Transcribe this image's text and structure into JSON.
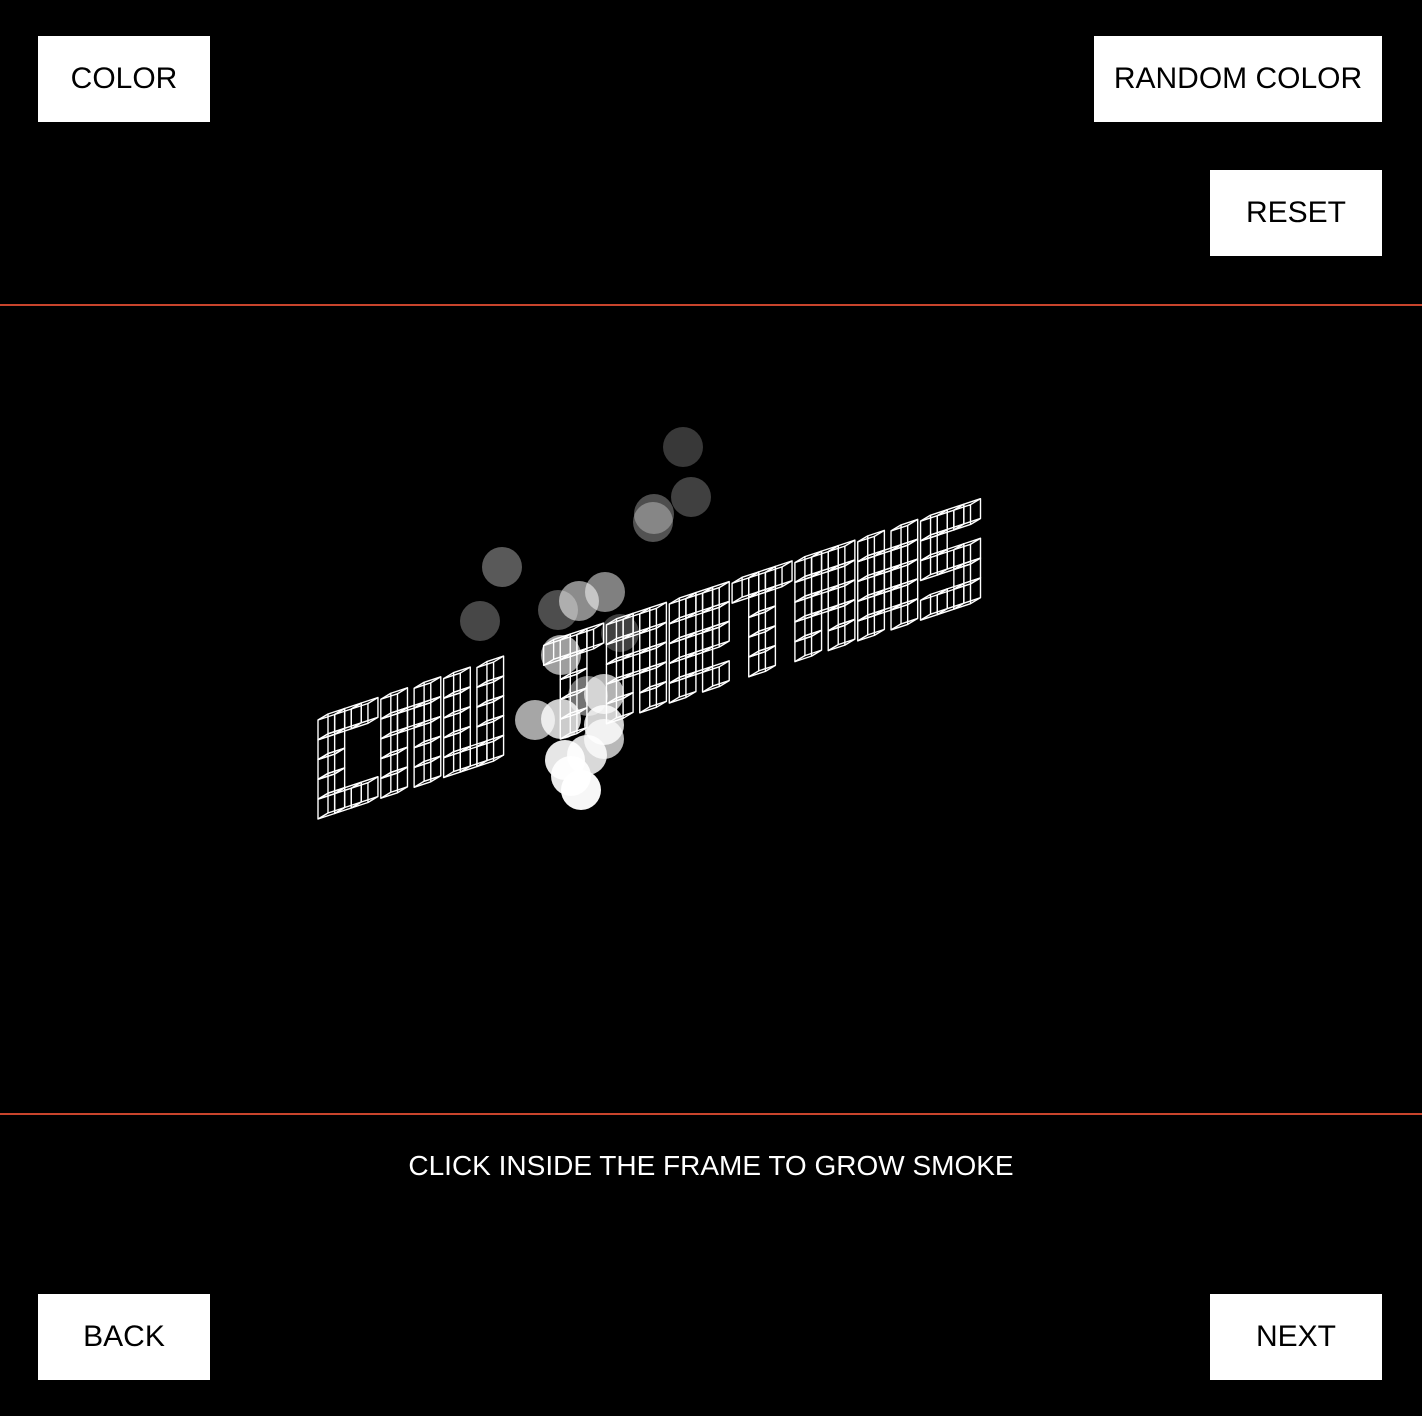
{
  "buttons": {
    "color": "COLOR",
    "random_color": "RANDOM COLOR",
    "reset": "RESET",
    "back": "BACK",
    "next": "NEXT"
  },
  "canvas": {
    "word": "CMU TARTANS",
    "stroke_color": "#ffffff",
    "smoke_color": "#ffffff",
    "frame_border_color": "#c8442c"
  },
  "instruction": "CLICK INSIDE THE FRAME TO GROW SMOKE"
}
